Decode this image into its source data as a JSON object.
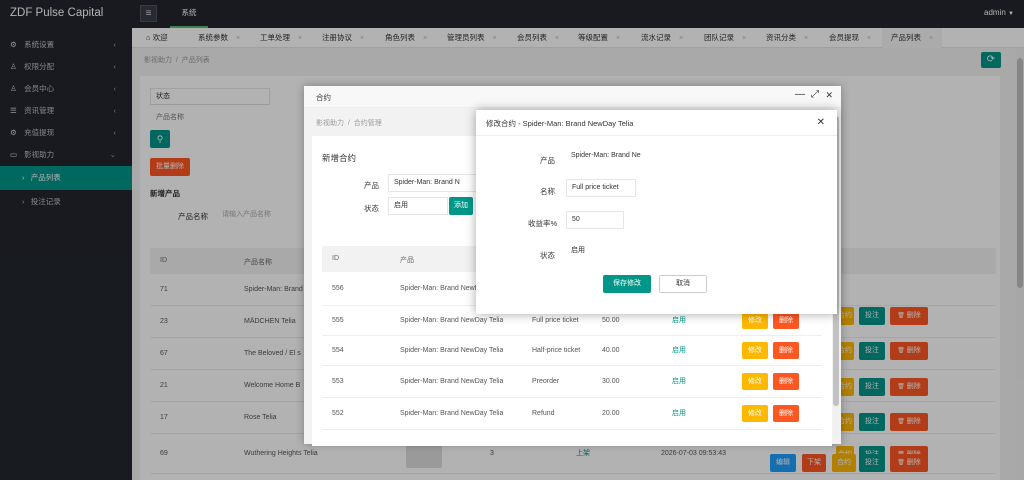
{
  "app": {
    "title": "ZDF Pulse Capital",
    "top_nav": "系统",
    "user": "admin",
    "user_caret": "▼",
    "menu_icon": "≡"
  },
  "sidebar": {
    "items": [
      {
        "label": "系统设置",
        "icon": "gear-icon",
        "glyph": "⚙",
        "chev": "‹"
      },
      {
        "label": "权限分配",
        "icon": "user-icon",
        "glyph": "♙",
        "chev": "‹"
      },
      {
        "label": "会员中心",
        "icon": "member-icon",
        "glyph": "♙",
        "chev": "‹"
      },
      {
        "label": "资讯管理",
        "icon": "list-icon",
        "glyph": "☰",
        "chev": "‹"
      },
      {
        "label": "充值提现",
        "icon": "gear-icon",
        "glyph": "⚙",
        "chev": "‹"
      },
      {
        "label": "影视助力",
        "icon": "monitor-icon",
        "glyph": "▭",
        "chev": "⌄"
      }
    ],
    "subitems": [
      {
        "label": "产品列表",
        "arrow": "›"
      },
      {
        "label": "投注记录",
        "arrow": "›"
      }
    ]
  },
  "tabs": [
    {
      "label": "欢迎",
      "icon": "⌂"
    },
    {
      "label": "系统参数"
    },
    {
      "label": "工单处理"
    },
    {
      "label": "注册协议"
    },
    {
      "label": "角色列表"
    },
    {
      "label": "管理员列表"
    },
    {
      "label": "会员列表"
    },
    {
      "label": "等级配置"
    },
    {
      "label": "流水记录"
    },
    {
      "label": "团队记录"
    },
    {
      "label": "资讯分类"
    },
    {
      "label": "会员提现"
    },
    {
      "label": "产品列表"
    }
  ],
  "tab_close": "×",
  "refresh_icon": "⟳",
  "page": {
    "breadcrumb": [
      "影视助力",
      "产品列表"
    ],
    "breadcrumb_sep": "/",
    "status_select": "状态",
    "product_name_select": "产品名称",
    "search_icon": "⚲",
    "batch_delete": "批量删除",
    "new_product_title": "新增产品",
    "product_name_label": "产品名称",
    "product_name_placeholder": "请输入产品名称",
    "columns": [
      "ID",
      "产品名称"
    ],
    "rows": [
      {
        "id": "71",
        "name": "Spider-Man: Brand"
      },
      {
        "id": "23",
        "name": "MÄDCHEN Telia"
      },
      {
        "id": "67",
        "name": "The Beloved / El s"
      },
      {
        "id": "21",
        "name": "Welcome Home B"
      },
      {
        "id": "17",
        "name": "Rose Telia"
      },
      {
        "id": "69",
        "name": "Wuthering Heights Telia",
        "count": "3",
        "status": "上架",
        "time": "2026-07-03 09:53:43"
      }
    ],
    "actions": {
      "edit": "编辑",
      "down": "下架",
      "contract": "合约",
      "bet": "投注",
      "delete": "删除",
      "trash_icon": "🗑"
    }
  },
  "dialog1": {
    "title": "合约",
    "min_icon": "—",
    "max_icon": "⤢",
    "close_icon": "✕",
    "breadcrumb": [
      "影视助力",
      "合约管理"
    ],
    "breadcrumb_sep": "/",
    "form_title": "新增合约",
    "product_label": "产品",
    "product_value": "Spider-Man: Brand N",
    "status_label": "状态",
    "status_value": "启用",
    "add_button": "添加",
    "columns": [
      "ID",
      "产品"
    ],
    "rows": [
      {
        "id": "556",
        "product": "Spider-Man: Brand NewDay Telia"
      },
      {
        "id": "555",
        "product": "Spider-Man: Brand NewDay Telia",
        "name": "Full price ticket",
        "rate": "50.00",
        "status": "启用"
      },
      {
        "id": "554",
        "product": "Spider-Man: Brand NewDay Telia",
        "name": "Half-price ticket",
        "rate": "40.00",
        "status": "启用"
      },
      {
        "id": "553",
        "product": "Spider-Man: Brand NewDay Telia",
        "name": "Preorder",
        "rate": "30.00",
        "status": "启用"
      },
      {
        "id": "552",
        "product": "Spider-Man: Brand NewDay Telia",
        "name": "Refund",
        "rate": "20.00",
        "status": "启用"
      }
    ],
    "actions": {
      "edit": "修改",
      "delete": "删除"
    }
  },
  "dialog2": {
    "title": "修改合约 - Spider-Man: Brand NewDay Telia",
    "close_icon": "✕",
    "product_label": "产品",
    "product_value": "Spider-Man: Brand Ne",
    "name_label": "名称",
    "name_value": "Full price ticket",
    "rate_label": "收益率%",
    "rate_value": "50",
    "status_label": "状态",
    "status_value": "启用",
    "save": "保存修改",
    "cancel": "取消"
  },
  "colors": {
    "teal": "#009688",
    "orange": "#ffb800",
    "red": "#ff5722",
    "blue": "#1e9fff",
    "dark": "#23262e"
  }
}
